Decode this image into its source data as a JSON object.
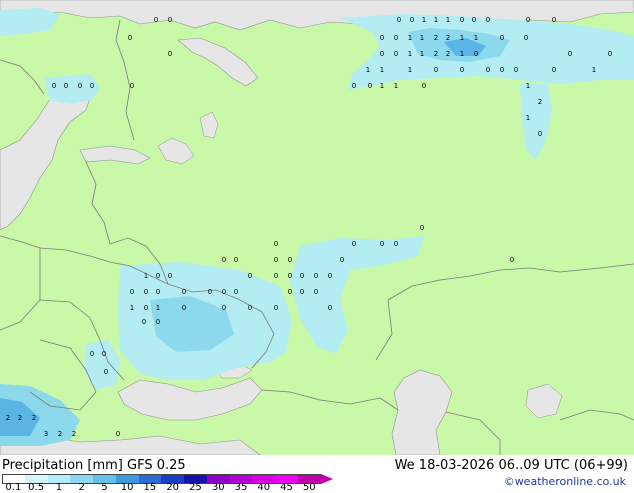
{
  "map": {
    "colors": {
      "land": "#c8f8a8",
      "water": "#e6e6e6",
      "border": "#7a7a7a",
      "coast": "#909090",
      "precip_light": "#b4ecf4",
      "precip_mid": "#8cd8ec",
      "precip_high": "#5ab4e6"
    },
    "value_labels": [
      {
        "t": "0"
      },
      {
        "t": "0"
      },
      {
        "t": "1"
      },
      {
        "t": "1"
      },
      {
        "t": "1"
      },
      {
        "t": "0"
      },
      {
        "t": "0"
      },
      {
        "t": "0"
      },
      {
        "t": "0"
      },
      {
        "t": "0"
      },
      {
        "t": "0"
      },
      {
        "t": "0"
      },
      {
        "t": "1"
      },
      {
        "t": "1"
      },
      {
        "t": "2"
      },
      {
        "t": "2"
      },
      {
        "t": "1"
      },
      {
        "t": "1"
      },
      {
        "t": "0"
      },
      {
        "t": "0"
      },
      {
        "t": "0"
      },
      {
        "t": "0"
      },
      {
        "t": "1"
      },
      {
        "t": "1"
      },
      {
        "t": "2"
      },
      {
        "t": "2"
      },
      {
        "t": "1"
      },
      {
        "t": "0"
      },
      {
        "t": "0"
      },
      {
        "t": "0"
      },
      {
        "t": "1"
      },
      {
        "t": "1"
      },
      {
        "t": "1"
      },
      {
        "t": "0"
      },
      {
        "t": "0"
      },
      {
        "t": "0"
      },
      {
        "t": "0"
      },
      {
        "t": "0"
      },
      {
        "t": "0"
      },
      {
        "t": "1"
      },
      {
        "t": "0"
      },
      {
        "t": "0"
      },
      {
        "t": "1"
      },
      {
        "t": "1"
      },
      {
        "t": "0"
      },
      {
        "t": "1"
      },
      {
        "t": "2"
      },
      {
        "t": "1"
      },
      {
        "t": "0"
      },
      {
        "t": "0"
      },
      {
        "t": "0"
      },
      {
        "t": "0"
      },
      {
        "t": "0"
      },
      {
        "t": "0"
      },
      {
        "t": "0"
      },
      {
        "t": "0"
      },
      {
        "t": "0"
      },
      {
        "t": "0"
      },
      {
        "t": "0"
      },
      {
        "t": "0"
      },
      {
        "t": "0"
      },
      {
        "t": "0"
      },
      {
        "t": "0"
      },
      {
        "t": "0"
      },
      {
        "t": "0"
      },
      {
        "t": "0"
      },
      {
        "t": "0"
      },
      {
        "t": "0"
      },
      {
        "t": "0"
      },
      {
        "t": "1"
      },
      {
        "t": "0"
      },
      {
        "t": "0"
      },
      {
        "t": "0"
      },
      {
        "t": "0"
      },
      {
        "t": "0"
      },
      {
        "t": "0"
      },
      {
        "t": "0"
      },
      {
        "t": "0"
      },
      {
        "t": "0"
      },
      {
        "t": "0"
      },
      {
        "t": "0"
      },
      {
        "t": "0"
      },
      {
        "t": "0"
      },
      {
        "t": "0"
      },
      {
        "t": "0"
      },
      {
        "t": "0"
      },
      {
        "t": "0"
      },
      {
        "t": "0"
      },
      {
        "t": "1"
      },
      {
        "t": "0"
      },
      {
        "t": "1"
      },
      {
        "t": "0"
      },
      {
        "t": "0"
      },
      {
        "t": "0"
      },
      {
        "t": "0"
      },
      {
        "t": "0"
      },
      {
        "t": "0"
      },
      {
        "t": "0"
      },
      {
        "t": "2"
      },
      {
        "t": "2"
      },
      {
        "t": "2"
      },
      {
        "t": "3"
      },
      {
        "t": "2"
      },
      {
        "t": "2"
      },
      {
        "t": "0"
      },
      {
        "t": "0"
      },
      {
        "t": "0"
      },
      {
        "t": "0"
      }
    ]
  },
  "footer": {
    "title": "Precipitation [mm]  GFS 0.25",
    "datetime": "We 18-03-2026 06..09 UTC (06+99)",
    "credit": "©weatheronline.co.uk",
    "legend": {
      "labels": [
        "0.1",
        "0.5",
        "1",
        "2",
        "5",
        "10",
        "15",
        "20",
        "25",
        "30",
        "35",
        "40",
        "45",
        "50"
      ],
      "colors": [
        "#ffffff",
        "#d8f4fc",
        "#b4ecf8",
        "#8cd8f0",
        "#64c0ec",
        "#3c9ae0",
        "#2a6cd4",
        "#1c3cc4",
        "#1414a8",
        "#8c00c8",
        "#b400d8",
        "#d800e0",
        "#f000f0",
        "#c000a8"
      ]
    }
  }
}
